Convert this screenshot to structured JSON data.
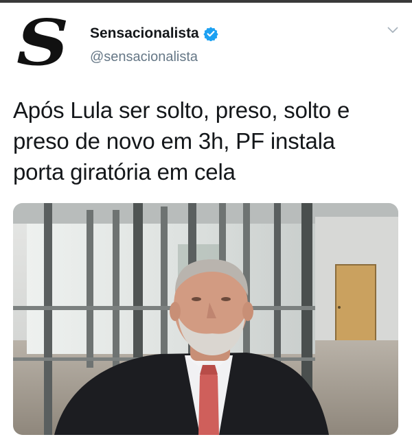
{
  "account": {
    "display_name": "Sensacionalista",
    "handle": "@sensacionalista",
    "avatar_letter": "S",
    "verified": true
  },
  "tweet": {
    "line1": "Após Lula ser solto, preso, solto e",
    "line2": "preso de novo em 3h, PF instala",
    "line3": "porta giratória em cela"
  },
  "media": {
    "description_icon": "photo"
  },
  "colors": {
    "verified_blue": "#1da1f2",
    "handle_gray": "#657786",
    "text": "#14171a"
  }
}
